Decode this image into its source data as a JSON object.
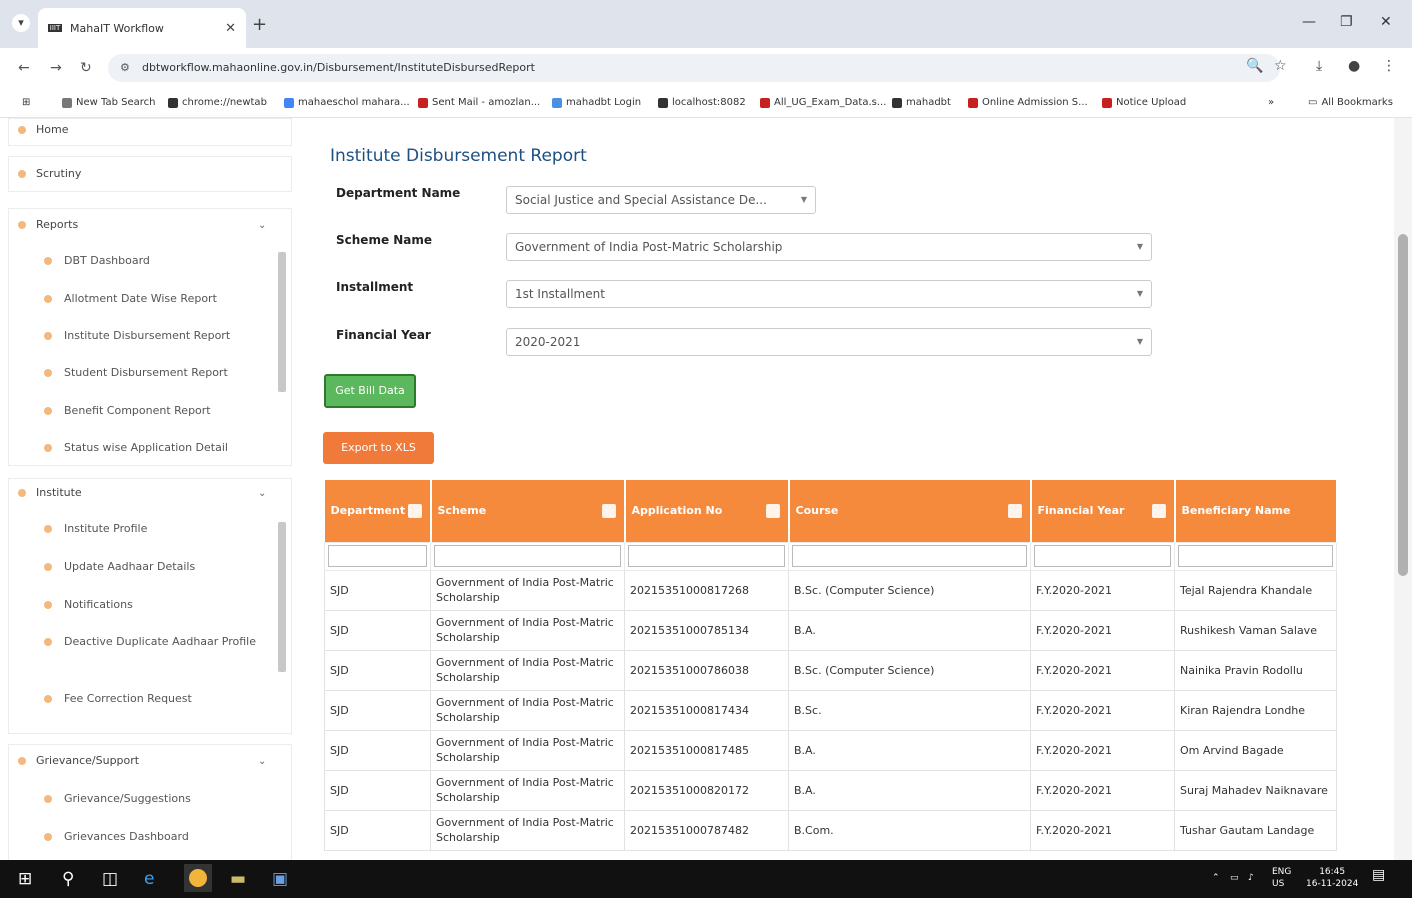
{
  "browser": {
    "tab_title": "MahaIT Workflow",
    "tab_fav": "IIIT",
    "url": "dbtworkflow.mahaonline.gov.in/Disbursement/InstituteDisbursedReport",
    "bookmarks": [
      {
        "label": "New Tab Search",
        "color": "#777777"
      },
      {
        "label": "chrome://newtab",
        "color": "#333333"
      },
      {
        "label": "mahaeschol mahara...",
        "color": "#4285f4"
      },
      {
        "label": "Sent Mail - amozlan...",
        "color": "#c5221f"
      },
      {
        "label": "mahadbt Login",
        "color": "#4a90e2"
      },
      {
        "label": "localhost:8082",
        "color": "#333333"
      },
      {
        "label": "All_UG_Exam_Data.s...",
        "color": "#c5221f"
      },
      {
        "label": "mahadbt",
        "color": "#333333"
      },
      {
        "label": "Online Admission S...",
        "color": "#c5221f"
      },
      {
        "label": "Notice Upload",
        "color": "#c5221f"
      }
    ],
    "all_bookmarks": "All Bookmarks"
  },
  "sidebar": {
    "home": "Home",
    "scrutiny": "Scrutiny",
    "reports": {
      "label": "Reports",
      "items": [
        "DBT Dashboard",
        "Allotment Date Wise Report",
        "Institute Disbursement Report",
        "Student Disbursement Report",
        "Benefit Component Report",
        "Status wise Application Detail"
      ]
    },
    "institute": {
      "label": "Institute",
      "items": [
        "Institute Profile",
        "Update Aadhaar Details",
        "Notifications",
        "Deactive Duplicate Aadhaar Profile",
        "Fee Correction Request"
      ]
    },
    "grievance": {
      "label": "Grievance/Support",
      "items": [
        "Grievance/Suggestions",
        "Grievances Dashboard"
      ]
    }
  },
  "main": {
    "title": "Institute Disbursement Report",
    "form": {
      "department_label": "Department Name",
      "department_value": "Social Justice and Special Assistance De...",
      "scheme_label": "Scheme Name",
      "scheme_value": "Government of India Post-Matric Scholarship",
      "installment_label": "Installment",
      "installment_value": "1st Installment",
      "fy_label": "Financial Year",
      "fy_value": "2020-2021"
    },
    "get_bill_button": "Get Bill Data",
    "export_button": "Export to XLS",
    "table": {
      "columns": [
        "Department",
        "Scheme",
        "Application No",
        "Course",
        "Financial Year",
        "Beneficiary Name"
      ],
      "rows": [
        [
          "SJD",
          "Government of India Post-Matric Scholarship",
          "202153510008172​68",
          "B.Sc. (Computer Science)",
          "F.Y.2020-2021",
          "Tejal Rajendra Khandale"
        ],
        [
          "SJD",
          "Government of India Post-Matric Scholarship",
          "202153510007851​34",
          "B.A.",
          "F.Y.2020-2021",
          "Rushikesh Vaman Salave"
        ],
        [
          "SJD",
          "Government of India Post-Matric Scholarship",
          "202153510007860​38",
          "B.Sc. (Computer Science)",
          "F.Y.2020-2021",
          "Nainika Pravin Rodollu"
        ],
        [
          "SJD",
          "Government of India Post-Matric Scholarship",
          "202153510008174​34",
          "B.Sc.",
          "F.Y.2020-2021",
          "Kiran Rajendra Londhe"
        ],
        [
          "SJD",
          "Government of India Post-Matric Scholarship",
          "202153510008174​85",
          "B.A.",
          "F.Y.2020-2021",
          "Om Arvind Bagade"
        ],
        [
          "SJD",
          "Government of India Post-Matric Scholarship",
          "202153510008201​72",
          "B.A.",
          "F.Y.2020-2021",
          "Suraj Mahadev Naiknavare"
        ],
        [
          "SJD",
          "Government of India Post-Matric Scholarship",
          "202153510007874​82",
          "B.Com.",
          "F.Y.2020-2021",
          "Tushar Gautam Landage"
        ]
      ]
    }
  },
  "taskbar": {
    "lang1": "ENG",
    "lang2": "US",
    "time": "16:45",
    "date": "16-11-2024"
  }
}
